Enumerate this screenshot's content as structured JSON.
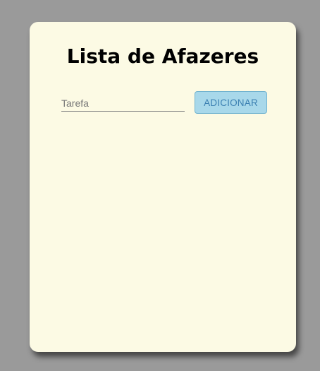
{
  "card": {
    "title": "Lista de Afazeres",
    "input": {
      "placeholder": "Tarefa",
      "value": ""
    },
    "add_button_label": "ADICIONAR",
    "tasks": []
  },
  "colors": {
    "page_background": "#9a9a9a",
    "card_background": "#fcfae4",
    "button_background": "#a8d8ea",
    "button_text": "#3a7fb1"
  }
}
